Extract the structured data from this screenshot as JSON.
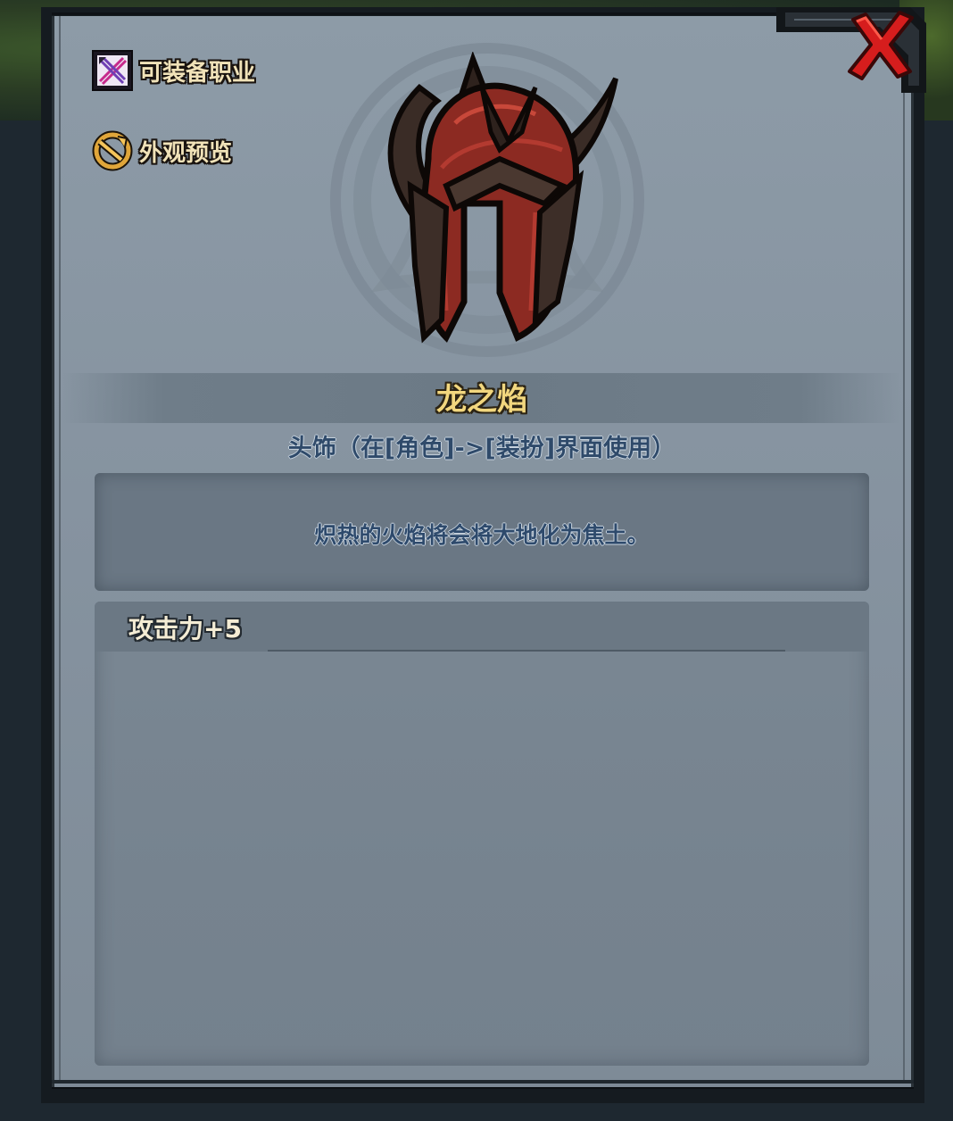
{
  "sidebar": {
    "equip_class": {
      "label": "可装备职业",
      "icon": "crossed-swords-icon"
    },
    "appearance_preview": {
      "label": "外观预览",
      "icon": "preview-swap-icon"
    }
  },
  "item": {
    "icon": "dragon-helmet-icon",
    "name": "龙之焰",
    "type": "头饰（在[角色]->[装扮]界面使用）",
    "description": "炽热的火焰将会将大地化为焦土。",
    "stats": [
      "攻击力+5"
    ]
  },
  "colors": {
    "name": "#f2d77e",
    "type": "#2f4a6a",
    "close": "#d11a1a",
    "panel": "#8693a0"
  }
}
